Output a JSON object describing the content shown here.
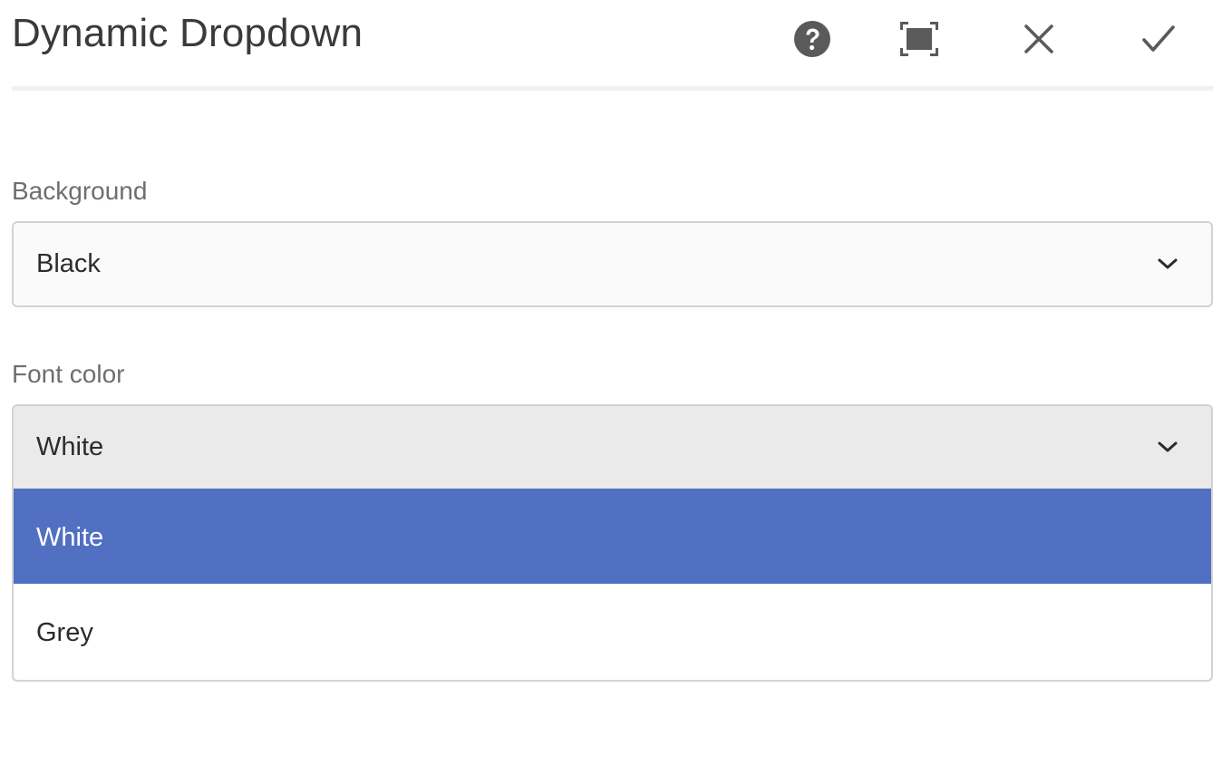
{
  "dialog": {
    "title": "Dynamic Dropdown",
    "toolbar": {
      "help_icon": "help-icon",
      "fullscreen_icon": "fullscreen-icon",
      "close_icon": "close-icon",
      "done_icon": "checkmark-icon"
    }
  },
  "fields": {
    "background": {
      "label": "Background",
      "value": "Black"
    },
    "font_color": {
      "label": "Font color",
      "value": "White",
      "open": true,
      "options": [
        {
          "label": "White",
          "selected": true
        },
        {
          "label": "Grey",
          "selected": false
        }
      ]
    }
  },
  "colors": {
    "accent": "#5170c2",
    "text": "#2c2c2c",
    "label": "#6e6e6e",
    "icon": "#5a5a5a"
  }
}
